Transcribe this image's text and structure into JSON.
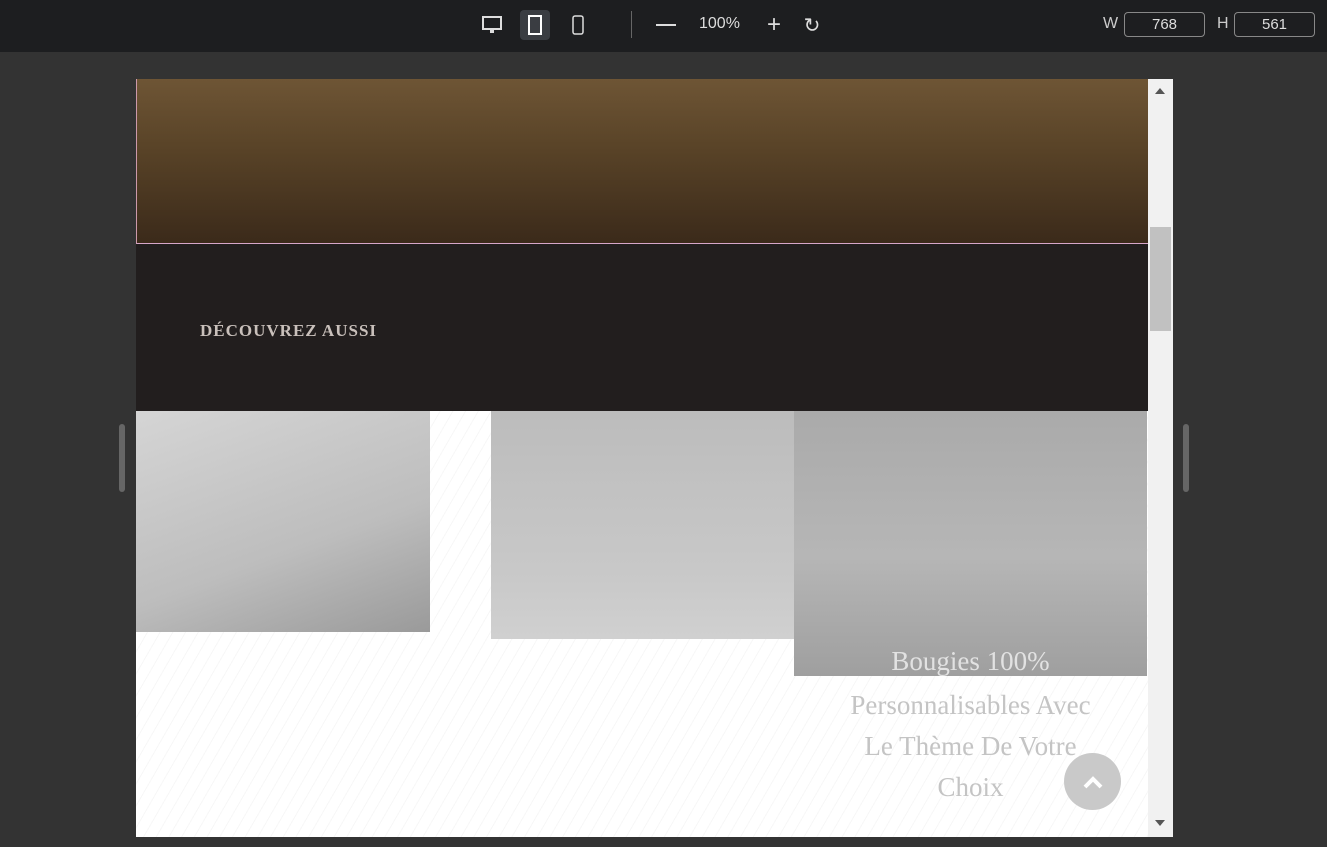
{
  "toolbar": {
    "zoom": "100%",
    "width_label": "W",
    "width_value": "768",
    "height_label": "H",
    "height_value": "561",
    "active_device": "tablet"
  },
  "page": {
    "section_heading": "DÉCOUVREZ AUSSI",
    "caption_hidden": "Bougies 100%",
    "caption_lines": [
      "Personnalisables Avec",
      "Le Thème De Votre",
      "Choix"
    ]
  }
}
